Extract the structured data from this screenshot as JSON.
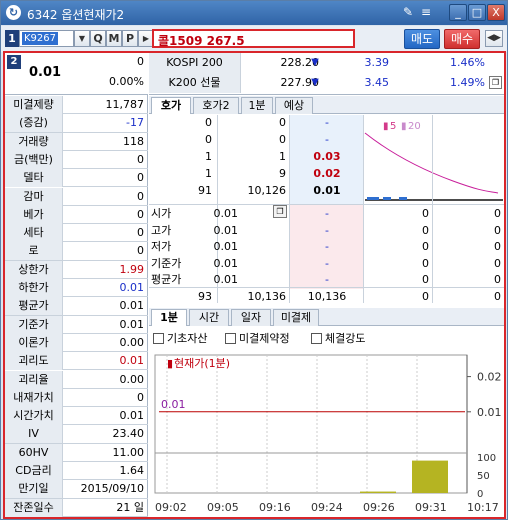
{
  "window": {
    "title": "6342 옵션현재가2",
    "title_icons": [
      "pin-icon",
      "menu-icon"
    ],
    "buttons": {
      "minimize": "_",
      "maximize": "□",
      "close": "X"
    }
  },
  "toolbar": {
    "screen_num": "1",
    "code": "K9267",
    "name": "콜1509 267.5",
    "search_buttons": [
      "Q",
      "M",
      "P"
    ],
    "sell_label": "매도",
    "buy_label": "매수"
  },
  "left": {
    "panel_num": "2",
    "price": "0.01",
    "change": "0",
    "change_pct": "0.00%",
    "rows": [
      {
        "label": "미결제량",
        "value": "11,787",
        "color": "black"
      },
      {
        "label": "(증감)",
        "value": "-17",
        "color": "blue"
      },
      {
        "label": "거래량",
        "value": "118",
        "color": "black"
      },
      {
        "label": "금(백만)",
        "value": "0",
        "color": "black"
      },
      {
        "label": "델타",
        "value": "0",
        "color": "black"
      },
      {
        "label": "감마",
        "value": "0",
        "color": "black"
      },
      {
        "label": "베가",
        "value": "0",
        "color": "black"
      },
      {
        "label": "세타",
        "value": "0",
        "color": "black"
      },
      {
        "label": "로",
        "value": "0",
        "color": "black"
      },
      {
        "label": "상한가",
        "value": "1.99",
        "color": "red"
      },
      {
        "label": "하한가",
        "value": "0.01",
        "color": "blue"
      },
      {
        "label": "평균가",
        "value": "0.01",
        "color": "black"
      },
      {
        "label": "기준가",
        "value": "0.01",
        "color": "black"
      },
      {
        "label": "이론가",
        "value": "0.00",
        "color": "black"
      },
      {
        "label": "괴리도",
        "value": "0.01",
        "color": "red"
      },
      {
        "label": "괴리율",
        "value": "0.00",
        "color": "black"
      },
      {
        "label": "내재가치",
        "value": "0",
        "color": "black"
      },
      {
        "label": "시간가치",
        "value": "0.01",
        "color": "black"
      },
      {
        "label": "IV",
        "value": "23.40",
        "color": "black"
      },
      {
        "label": "60HV",
        "value": "11.00",
        "color": "black"
      },
      {
        "label": "CD금리",
        "value": "1.64",
        "color": "black"
      },
      {
        "label": "만기일",
        "value": "2015/09/10",
        "color": "black"
      },
      {
        "label": "잔존일수",
        "value": "21 일",
        "color": "black"
      }
    ]
  },
  "indices": [
    {
      "name": "KOSPI 200",
      "value": "228.20",
      "arrow": "▼",
      "change": "3.39",
      "pct": "1.46%"
    },
    {
      "name": "K200 선물",
      "value": "227.90",
      "arrow": "▼",
      "change": "3.45",
      "pct": "1.49%"
    }
  ],
  "book_tabs": [
    "호가",
    "호가2",
    "1분",
    "예상"
  ],
  "orderbook": {
    "ask_rows": [
      {
        "c1": "0",
        "c2": "0",
        "price": "-"
      },
      {
        "c1": "0",
        "c2": "0",
        "price": "-"
      },
      {
        "c1": "1",
        "c2": "1",
        "price": "0.03"
      },
      {
        "c1": "1",
        "c2": "9",
        "price": "0.02"
      },
      {
        "c1": "91",
        "c2": "10,126",
        "price": "0.01"
      }
    ],
    "info_labels": [
      "시가",
      "고가",
      "저가",
      "기준가",
      "평균가"
    ],
    "info_values": [
      "0.01",
      "0.01",
      "0.01",
      "0.01",
      "0.01"
    ],
    "bid_rows": [
      {
        "price": "-",
        "c1": "0",
        "c2": "0"
      },
      {
        "price": "-",
        "c1": "0",
        "c2": "0"
      },
      {
        "price": "-",
        "c1": "0",
        "c2": "0"
      },
      {
        "price": "-",
        "c1": "0",
        "c2": "0"
      },
      {
        "price": "-",
        "c1": "0",
        "c2": "0"
      }
    ],
    "total": {
      "c1": "93",
      "c2": "10,136",
      "c3": "10,136",
      "c4": "0",
      "c5": "0"
    },
    "mini_legend": [
      "5",
      "20"
    ]
  },
  "chart_tabs": [
    "1분",
    "시간",
    "일자",
    "미결제"
  ],
  "chart_checks": [
    "기초자산",
    "미결제약정",
    "체결강도"
  ],
  "chart_data": {
    "type": "line",
    "legend": "현재가(1분)",
    "line_label": "0.01",
    "y_ticks": [
      "0.02",
      "0.01",
      "0"
    ],
    "vol_ticks": [
      "100",
      "50",
      "0"
    ],
    "x_labels": [
      "09:02",
      "09:05",
      "09:16",
      "09:24",
      "09:26",
      "09:31",
      "10:17"
    ],
    "price": 0.01,
    "volume": [
      0,
      0,
      0,
      0,
      4,
      90
    ]
  }
}
